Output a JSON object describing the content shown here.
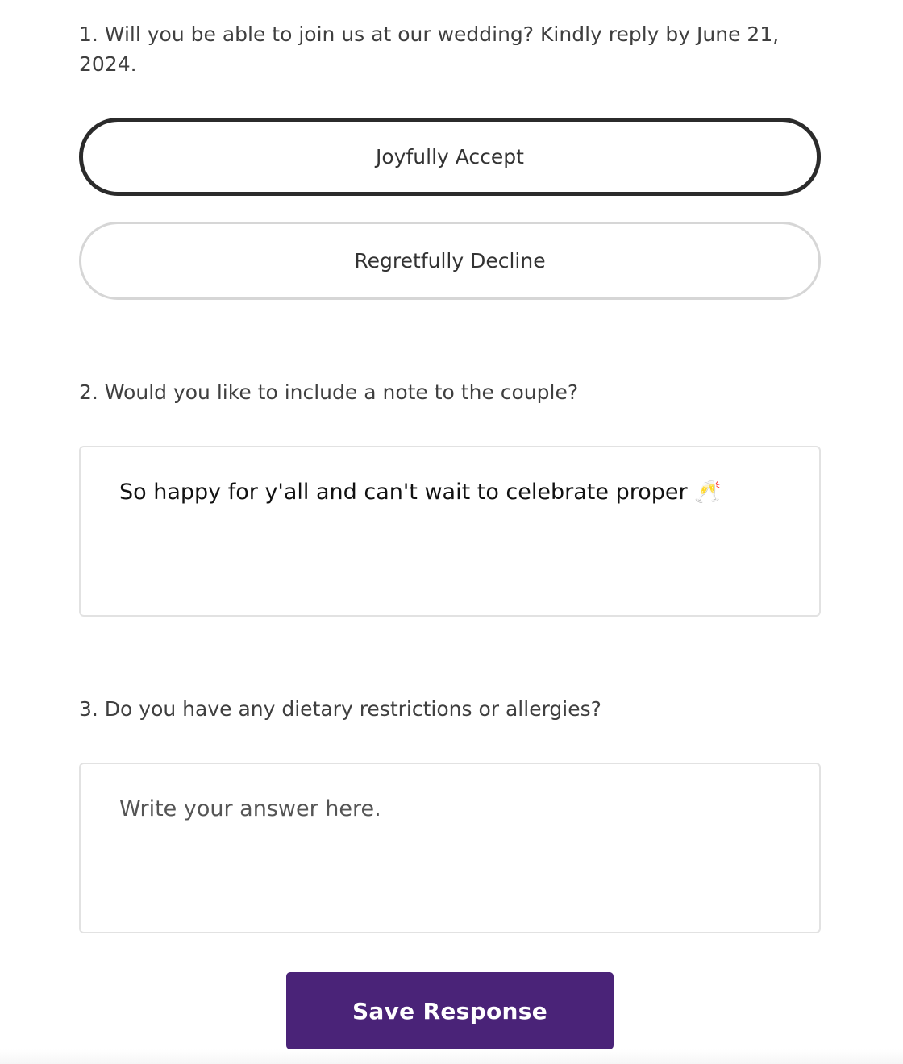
{
  "questions": [
    {
      "label": "1. Will you be able to join us at our wedding? Kindly reply by June 21, 2024.",
      "options": [
        {
          "label": "Joyfully Accept",
          "selected": true
        },
        {
          "label": "Regretfully Decline",
          "selected": false
        }
      ]
    },
    {
      "label": "2. Would you like to include a note to the couple?",
      "value": "So happy for y'all and can't wait to celebrate proper 🥂",
      "placeholder": ""
    },
    {
      "label": "3. Do you have any dietary restrictions or allergies?",
      "value": "",
      "placeholder": "Write your answer here."
    }
  ],
  "save_button": {
    "label": "Save Response"
  },
  "colors": {
    "accent": "#4a2378",
    "selected_border": "#2b2b2b",
    "unselected_border": "#d6d6d6"
  }
}
